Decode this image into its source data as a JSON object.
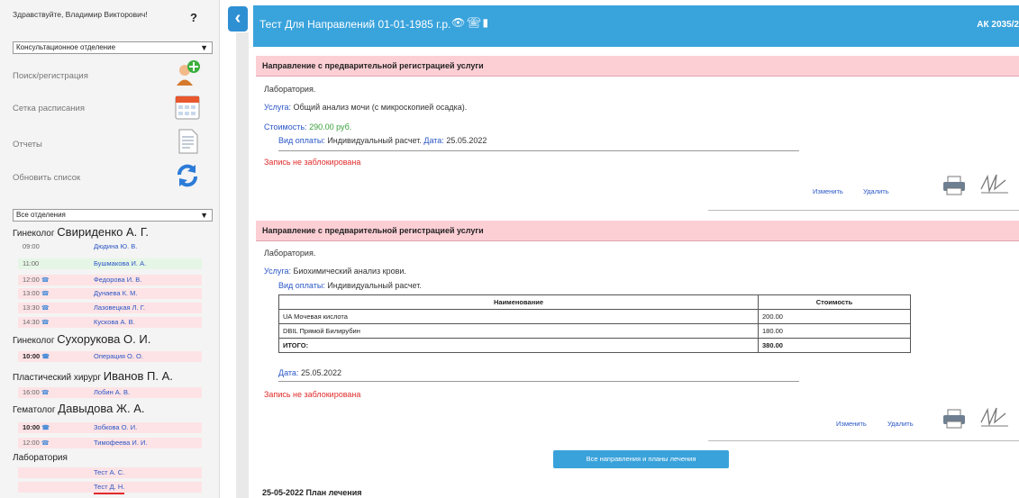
{
  "sidebar": {
    "greeting": "Здравствуйте, Владимир Викторович!",
    "help_icon": "?",
    "department_select": "Консультационное отделение",
    "menu": [
      {
        "label": "Поиск/регистрация",
        "icon": "add-user-icon"
      },
      {
        "label": "Сетка расписания",
        "icon": "calendar-icon"
      },
      {
        "label": "Отчеты",
        "icon": "document-icon"
      },
      {
        "label": "Обновить список",
        "icon": "refresh-icon"
      }
    ],
    "filter_select": "Все отделения",
    "doctors": [
      {
        "role": "Гинеколог",
        "name": "Свириденко А. Г."
      },
      {
        "role": "Гинеколог",
        "name": "Сухорукова О. И."
      },
      {
        "role": "Пластический хирург",
        "name": "Иванов П. А."
      },
      {
        "role": "Гематолог",
        "name": "Давыдова Ж. А."
      },
      {
        "role": "",
        "name": "Лаборатория"
      }
    ],
    "slots": [
      {
        "time": "09:00",
        "name": "Дюдина Ю. В."
      },
      {
        "time": "11:00",
        "name": "Бушмакова И. А."
      },
      {
        "time": "12:00",
        "name": "Федорова И. В."
      },
      {
        "time": "13:00",
        "name": "Дунаева К. М."
      },
      {
        "time": "13:30",
        "name": "Лазовецкая Л. Г."
      },
      {
        "time": "14:30",
        "name": "Кускова А. В."
      },
      {
        "time": "10:00",
        "name": "Операция О. О."
      },
      {
        "time": "16:00",
        "name": "Лобин А. В."
      },
      {
        "time": "10:00",
        "name": "Зобкова О. И."
      },
      {
        "time": "12:00",
        "name": "Тимофеева И. И."
      },
      {
        "time": "",
        "name": "Тест А. С."
      },
      {
        "time": "",
        "name": "Тест Д. Н."
      }
    ]
  },
  "header": {
    "title": "Тест Для Направлений 01-01-1985 г.р.",
    "code": "АК 2035/2"
  },
  "referrals": [
    {
      "heading": "Направление с предварительной регистрацией услуги",
      "dept": "Лаборатория.",
      "service_label": "Услуга:",
      "service": "Общий анализ мочи (с микроскопией осадка).",
      "cost_label": "Стоимость:",
      "cost": "290.00 руб.",
      "payment_label": "Вид оплаты:",
      "payment": "Индивидуальный расчет.",
      "date_label": "Дата:",
      "date": "25.05.2022",
      "lock_status": "Запись не заблокирована",
      "edit": "Изменить",
      "delete": "Удалить"
    },
    {
      "heading": "Направление с предварительной регистрацией услуги",
      "dept": "Лаборатория.",
      "service_label": "Услуга:",
      "service": "Биохимический анализ крови.",
      "payment_label": "Вид оплаты:",
      "payment": "Индивидуальный расчет.",
      "table": {
        "headers": [
          "Наименование",
          "Стоимость"
        ],
        "rows": [
          [
            "UA Мочевая кислота",
            "200.00"
          ],
          [
            "DBIL Прямой Билирубин",
            "180.00"
          ],
          [
            "ИТОГО:",
            "380.00"
          ]
        ]
      },
      "date_label": "Дата:",
      "date": "25.05.2022",
      "lock_status": "Запись не заблокирована",
      "edit": "Изменить",
      "delete": "Удалить"
    }
  ],
  "all_button": "Все направления и планы лечения",
  "plan_heading": "25-05-2022 План лечения",
  "colors": {
    "accent": "#39a3dc",
    "pink": "#fccfd5",
    "link": "#2a56c6",
    "alert": "#e02b2b"
  }
}
